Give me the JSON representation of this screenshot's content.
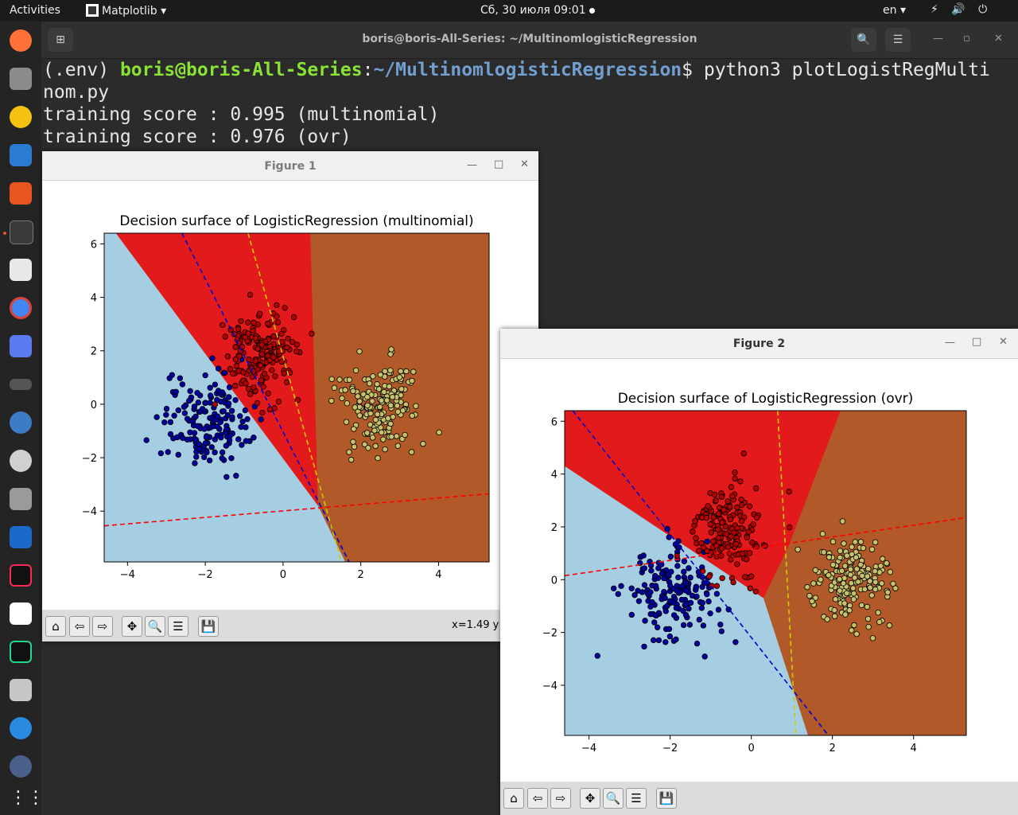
{
  "topbar": {
    "activities": "Activities",
    "app_name": "Matplotlib",
    "clock": "Сб, 30 июля  09:01",
    "lang": "en",
    "tray": "⚡ 🔊 ⏻"
  },
  "terminal": {
    "title": "boris@boris-All-Series: ~/MultinomlogisticRegression",
    "env": "(.env) ",
    "user": "boris@boris-All-Series",
    "path": "~/MultinomlogisticRegression",
    "command": "$ python3 plotLogistRegMulti",
    "command_wrap": "nom.py",
    "output": [
      "training score : 0.995 (multinomial)",
      "training score : 0.976 (ovr)"
    ],
    "search_icon": "🔍",
    "menu_icon": "☰"
  },
  "figure1": {
    "title": "Figure 1",
    "status": "x=1.49 y",
    "toolbar": [
      "home-icon",
      "back-icon",
      "forward-icon",
      "pan-icon",
      "zoom-icon",
      "configure-icon",
      "save-icon"
    ]
  },
  "figure2": {
    "title": "Figure 2",
    "toolbar": [
      "home-icon",
      "back-icon",
      "forward-icon",
      "pan-icon",
      "zoom-icon",
      "configure-icon",
      "save-icon"
    ]
  },
  "colors": {
    "class0": "#a6cee3",
    "class1": "#e31a1c",
    "class2": "#b15928",
    "pts0": "#0000a0",
    "pts1": "#b40000",
    "pts2": "#c7c26a",
    "line0": "#0000cc",
    "line1": "#ff0000",
    "line2": "#cccc00"
  },
  "chart_data": [
    {
      "type": "scatter",
      "title": "Decision surface of LogisticRegression (multinomial)",
      "xlim": [
        -4.6,
        5.3
      ],
      "ylim": [
        -5.9,
        6.4
      ],
      "xticks": [
        "−4",
        "−2",
        "0",
        "2",
        "4"
      ],
      "xtick_values": [
        -4,
        -2,
        0,
        2,
        4
      ],
      "yticks": [
        "6",
        "4",
        "2",
        "0",
        "−2",
        "−4"
      ],
      "ytick_values": [
        6,
        4,
        2,
        0,
        -2,
        -4
      ],
      "series": [
        {
          "center": [
            -2.0,
            -0.6
          ],
          "spread": [
            0.55,
            0.85
          ],
          "count": 170
        },
        {
          "center": [
            -0.6,
            1.9
          ],
          "spread": [
            0.45,
            0.85
          ],
          "count": 170
        },
        {
          "center": [
            2.5,
            0.0
          ],
          "spread": [
            0.5,
            0.85
          ],
          "count": 170
        }
      ],
      "boundaries": [
        {
          "from": [
            -4.6,
            6.4
          ],
          "to": [
            0.9,
            -3.8
          ],
          "to2": [
            1.6,
            -5.9
          ]
        },
        {
          "from": [
            0.7,
            6.4
          ],
          "to": [
            0.9,
            -3.8
          ]
        },
        {
          "from": [
            0.9,
            -3.8
          ],
          "to": [
            1.6,
            -5.9
          ]
        }
      ],
      "lines": [
        {
          "class": 0,
          "points": [
            [
              -2.6,
              6.4
            ],
            [
              1.7,
              -5.9
            ]
          ]
        },
        {
          "class": 1,
          "points": [
            [
              -4.6,
              -4.55
            ],
            [
              5.3,
              -3.35
            ]
          ]
        },
        {
          "class": 2,
          "points": [
            [
              -0.9,
              6.4
            ],
            [
              1.5,
              -5.9
            ]
          ]
        }
      ]
    },
    {
      "type": "scatter",
      "title": "Decision surface of LogisticRegression (ovr)",
      "xlim": [
        -4.6,
        5.3
      ],
      "ylim": [
        -5.9,
        6.4
      ],
      "xticks": [
        "−4",
        "−2",
        "0",
        "2",
        "4"
      ],
      "xtick_values": [
        -4,
        -2,
        0,
        2,
        4
      ],
      "yticks": [
        "6",
        "4",
        "2",
        "0",
        "−2",
        "−4"
      ],
      "ytick_values": [
        6,
        4,
        2,
        0,
        -2,
        -4
      ],
      "series": [
        {
          "center": [
            -2.0,
            -0.6
          ],
          "spread": [
            0.55,
            0.85
          ],
          "count": 170
        },
        {
          "center": [
            -0.6,
            1.9
          ],
          "spread": [
            0.45,
            0.85
          ],
          "count": 170
        },
        {
          "center": [
            2.5,
            0.0
          ],
          "spread": [
            0.5,
            0.85
          ],
          "count": 170
        }
      ],
      "boundaries": [],
      "lines": [
        {
          "class": 0,
          "points": [
            [
              -4.4,
              6.4
            ],
            [
              1.9,
              -5.9
            ]
          ]
        },
        {
          "class": 1,
          "points": [
            [
              -4.6,
              0.15
            ],
            [
              5.3,
              2.35
            ]
          ]
        },
        {
          "class": 2,
          "points": [
            [
              0.65,
              6.4
            ],
            [
              1.1,
              -5.9
            ]
          ]
        }
      ]
    }
  ]
}
